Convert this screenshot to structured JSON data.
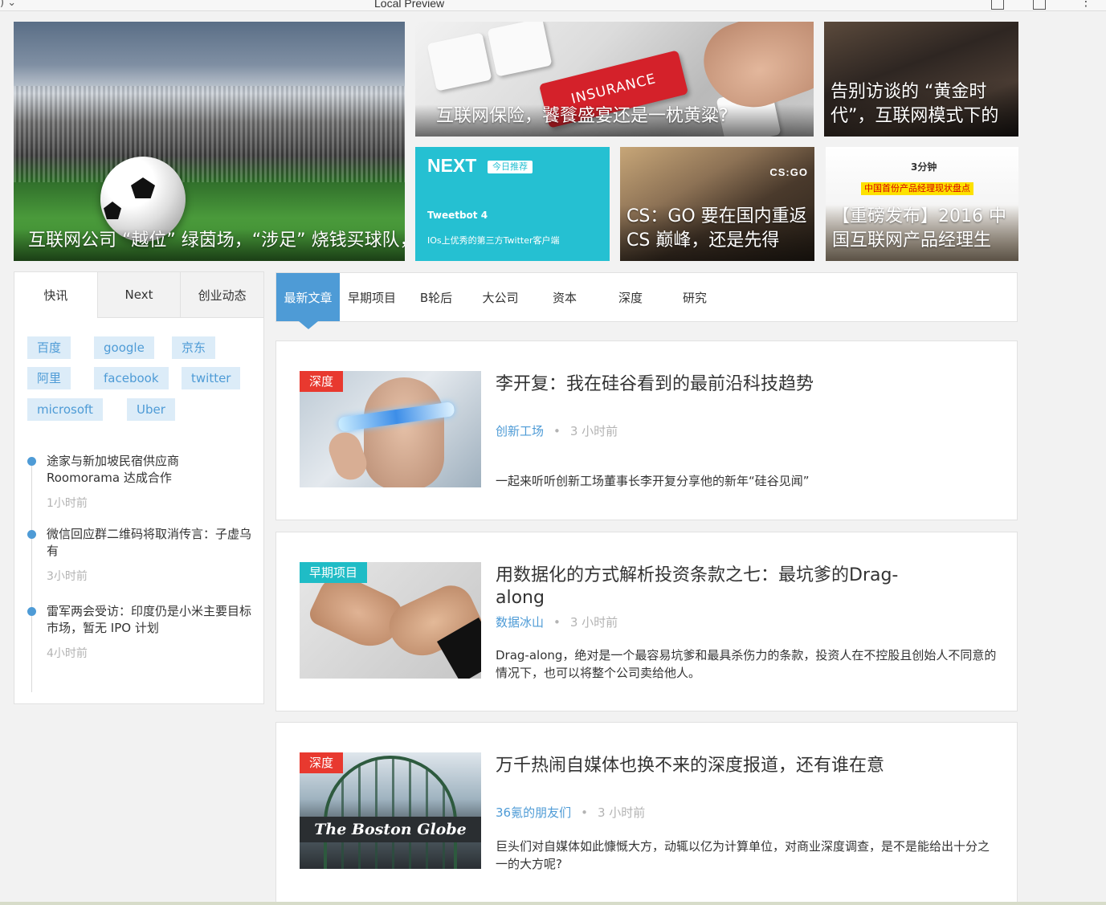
{
  "browser": {
    "title": "Local Preview"
  },
  "hero": {
    "soccer": "互联网公司 “越位” 绿茵场，“涉足” 烧钱买球队，",
    "insurance": {
      "caption": "互联网保险，饕餮盛宴还是一枕黄粱?",
      "key_label": "INSURANCE"
    },
    "interview": "告别访谈的 “黄金时代”，互联网模式下的",
    "next": {
      "brand": "NEXT",
      "badge": "今日推荐",
      "name": "Tweetbot 4",
      "desc": "IOs上优秀的第三方Twitter客户端"
    },
    "csgo": {
      "caption": "CS：GO 要在国内重返 CS 巅峰，还是先得",
      "logo": "CS:GO"
    },
    "pm": {
      "caption": "【重磅发布】2016 中国互联网产品经理生",
      "logo": "3分钟",
      "banner": "中国首份产品经理现状盘点"
    }
  },
  "sidebar": {
    "tabs": [
      "快讯",
      "Next",
      "创业动态"
    ],
    "tags": [
      "百度",
      "google",
      "京东",
      "阿里",
      "facebook",
      "twitter",
      "microsoft",
      "Uber"
    ],
    "news": [
      {
        "title": "途家与新加坡民宿供应商 Roomorama 达成合作",
        "time": "1小时前"
      },
      {
        "title": "微信回应群二维码将取消传言：子虚乌有",
        "time": "3小时前"
      },
      {
        "title": "雷军两会受访：印度仍是小米主要目标市场，暂无 IPO 计划",
        "time": "4小时前"
      }
    ]
  },
  "categories": [
    "最新文章",
    "早期项目",
    "B轮后",
    "大公司",
    "资本",
    "深度",
    "研究"
  ],
  "articles": [
    {
      "ribbon": "深度",
      "title": "李开复：我在硅谷看到的最前沿科技趋势",
      "source": "创新工场",
      "time": "3 小时前",
      "summary": "一起来听听创新工场董事长李开复分享他的新年“硅谷见闻”"
    },
    {
      "ribbon": "早期项目",
      "title": "用数据化的方式解析投资条款之七：最坑爹的Drag-along",
      "source": "数据冰山",
      "time": "3 小时前",
      "summary": "Drag-along，绝对是一个最容易坑爹和最具杀伤力的条款，投资人在不控股且创始人不同意的情况下，也可以将整个公司卖给他人。"
    },
    {
      "ribbon": "深度",
      "title": "万千热闹自媒体也换不来的深度报道，还有谁在意",
      "source": "36氪的朋友们",
      "time": "3 小时前",
      "summary": "巨头们对自媒体如此慷慨大方，动辄以亿为计算单位，对商业深度调查，是不是能给出十分之一的大方呢?",
      "thumb_text": "The Boston Globe"
    }
  ]
}
